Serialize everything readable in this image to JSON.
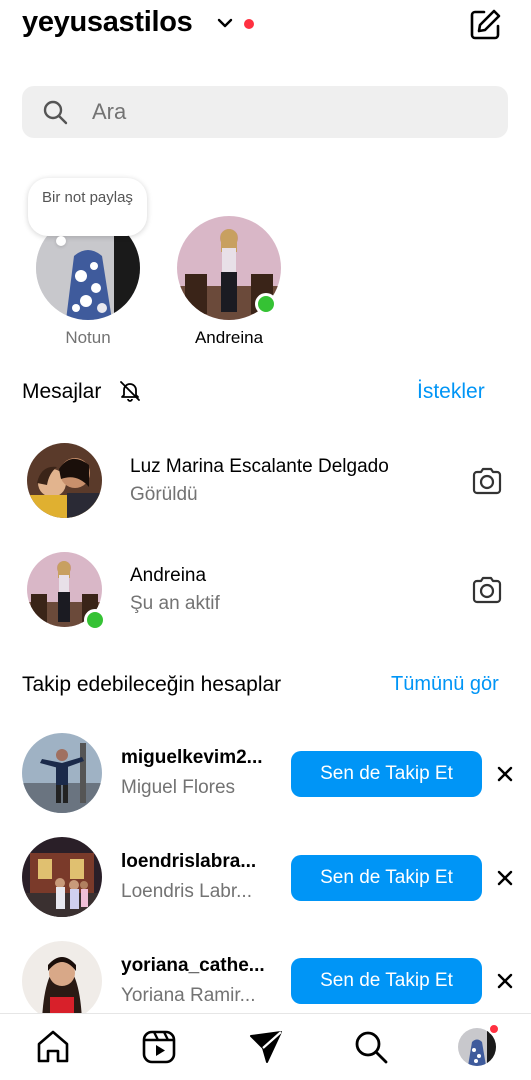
{
  "header": {
    "username": "yeyusastilos"
  },
  "search": {
    "placeholder": "Ara"
  },
  "notes": {
    "bubble_text": "Bir not paylaş",
    "items": [
      {
        "label": "Notun"
      },
      {
        "label": "Andreina",
        "online": true
      }
    ]
  },
  "messages": {
    "title": "Mesajlar",
    "requests_link": "İstekler",
    "threads": [
      {
        "name": "Luz Marina Escalante Delgado",
        "status": "Görüldü"
      },
      {
        "name": "Andreina",
        "status": "Şu an aktif",
        "online": true
      }
    ]
  },
  "suggestions": {
    "title": "Takip edebileceğin hesaplar",
    "see_all": "Tümünü gör",
    "follow_label": "Sen de Takip Et",
    "items": [
      {
        "username": "miguelkevim2...",
        "name": "Miguel Flores"
      },
      {
        "username": "loendrislabra...",
        "name": "Loendris Labr..."
      },
      {
        "username": "yoriana_cathe...",
        "name": "Yoriana Ramir..."
      }
    ]
  },
  "tabbar": {
    "icons": [
      "home-icon",
      "reels-icon",
      "direct-icon",
      "search-icon",
      "profile-avatar"
    ]
  }
}
